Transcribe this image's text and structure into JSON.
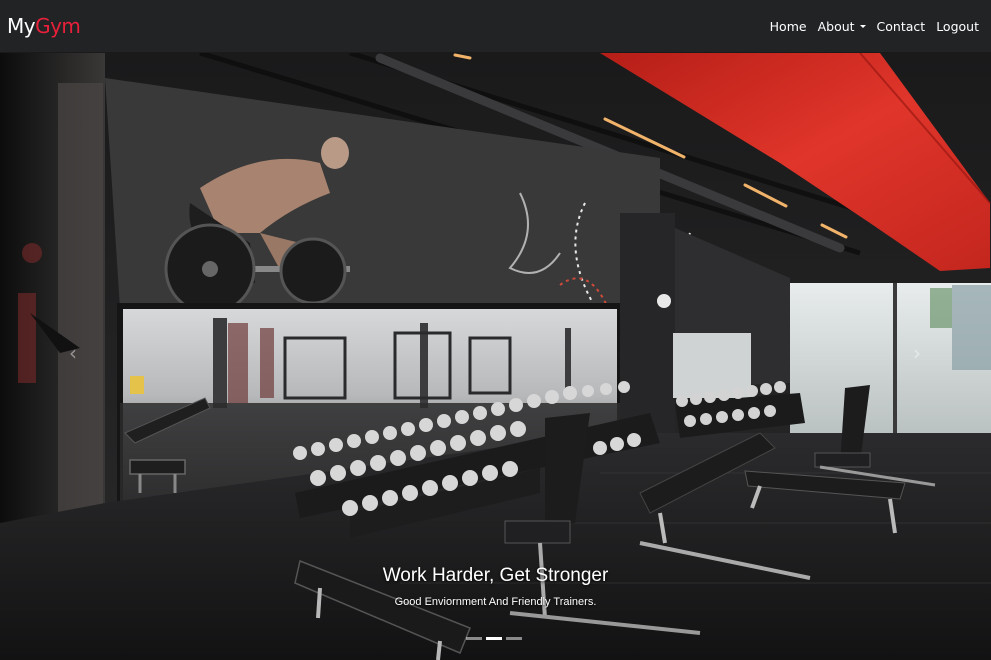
{
  "navbar": {
    "brand_part1": "My",
    "brand_part2": "Gym",
    "links": [
      {
        "label": "Home"
      },
      {
        "label": "About"
      },
      {
        "label": "Contact"
      },
      {
        "label": "Logout"
      }
    ]
  },
  "carousel": {
    "caption_title": "Work Harder, Get Stronger",
    "caption_subtitle": "Good Enviornment And Friendly Trainers.",
    "indicator_count": 3,
    "active_index": 1,
    "prev_icon": "chevron-left-icon",
    "next_icon": "chevron-right-icon"
  },
  "colors": {
    "navbar_bg": "#222325",
    "brand_accent": "#e8203a",
    "duct_red": "#c8241d"
  }
}
